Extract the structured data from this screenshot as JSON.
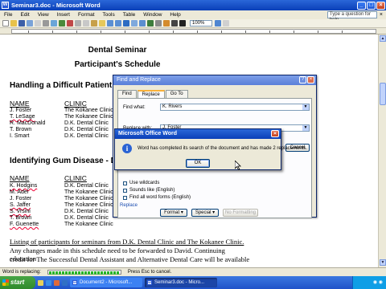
{
  "window": {
    "title": "Seminar3.doc - Microsoft Word"
  },
  "menu": {
    "items": [
      "File",
      "Edit",
      "View",
      "Insert",
      "Format",
      "Tools",
      "Table",
      "Window",
      "Help"
    ],
    "help_placeholder": "Type a question for help"
  },
  "toolbar": {
    "zoom": "100%"
  },
  "document": {
    "title1": "Dental Seminar",
    "title2": "Participant's Schedule",
    "section1": {
      "heading": "Handling a Difficult Patient - Dr",
      "col_name": "NAME",
      "col_clinic": "CLINIC",
      "names": [
        "J. Foster",
        "T. LeSage",
        "R. MacDonald",
        "T. Brown",
        "I. Smart"
      ],
      "clinics": [
        "The Kokanee Clinic",
        "The Kokanee Clinic",
        "D.K. Dental Clinic",
        "D.K. Dental Clinic",
        "D.K. Dental Clinic"
      ]
    },
    "section2": {
      "heading": "Identifying Gum Disease - Dr.",
      "col_name": "NAME",
      "col_clinic": "CLINIC",
      "names": [
        "K. Hodgins",
        "M. Adel",
        "J. Foster",
        "S. Jaffer",
        "S. Vrsini",
        "T. Brown",
        "F. Guenette"
      ],
      "clinics": [
        "D.K. Dental Clinic",
        "The Kokanee Clinic",
        "The Kokanee Clinic",
        "The Kokanee Clinic",
        "D.K. Dental Clinic",
        "D.K. Dental Clinic",
        "The Kokanee Clinic"
      ]
    },
    "footer_lines": [
      "Listing of participants for seminars from D.K. Dental Clinic and The Kokanee Clinic.",
      "Any changes made in this schedule need to be forwarded to David.  Continuing education",
      "credit for The Successful Dental Assistant and Alternative Dental Care will be available"
    ]
  },
  "find_replace": {
    "title": "Find and Replace",
    "tabs": [
      "Find",
      "Replace",
      "Go To"
    ],
    "find_label": "Find what:",
    "find_value": "K. Rivers",
    "replace_label": "Replace with:",
    "replace_value": "J. Foster",
    "cancel_label": "Cancel",
    "options": [
      "Use wildcards",
      "Sounds like (English)",
      "Find all word forms (English)"
    ],
    "replace_section": "Replace",
    "format_label": "Format",
    "special_label": "Special",
    "no_formatting_label": "No Formatting"
  },
  "message_box": {
    "title": "Microsoft Office Word",
    "text": "Word has completed its search of the document and has made 2 replacements.",
    "ok_label": "OK"
  },
  "statusbar": {
    "text": "Word is replacing:",
    "esc_text": "Press Esc to cancel."
  },
  "taskbar": {
    "start_label": "start",
    "tasks": [
      "Document2 - Microsoft...",
      "Seminar3.doc - Micro..."
    ]
  }
}
